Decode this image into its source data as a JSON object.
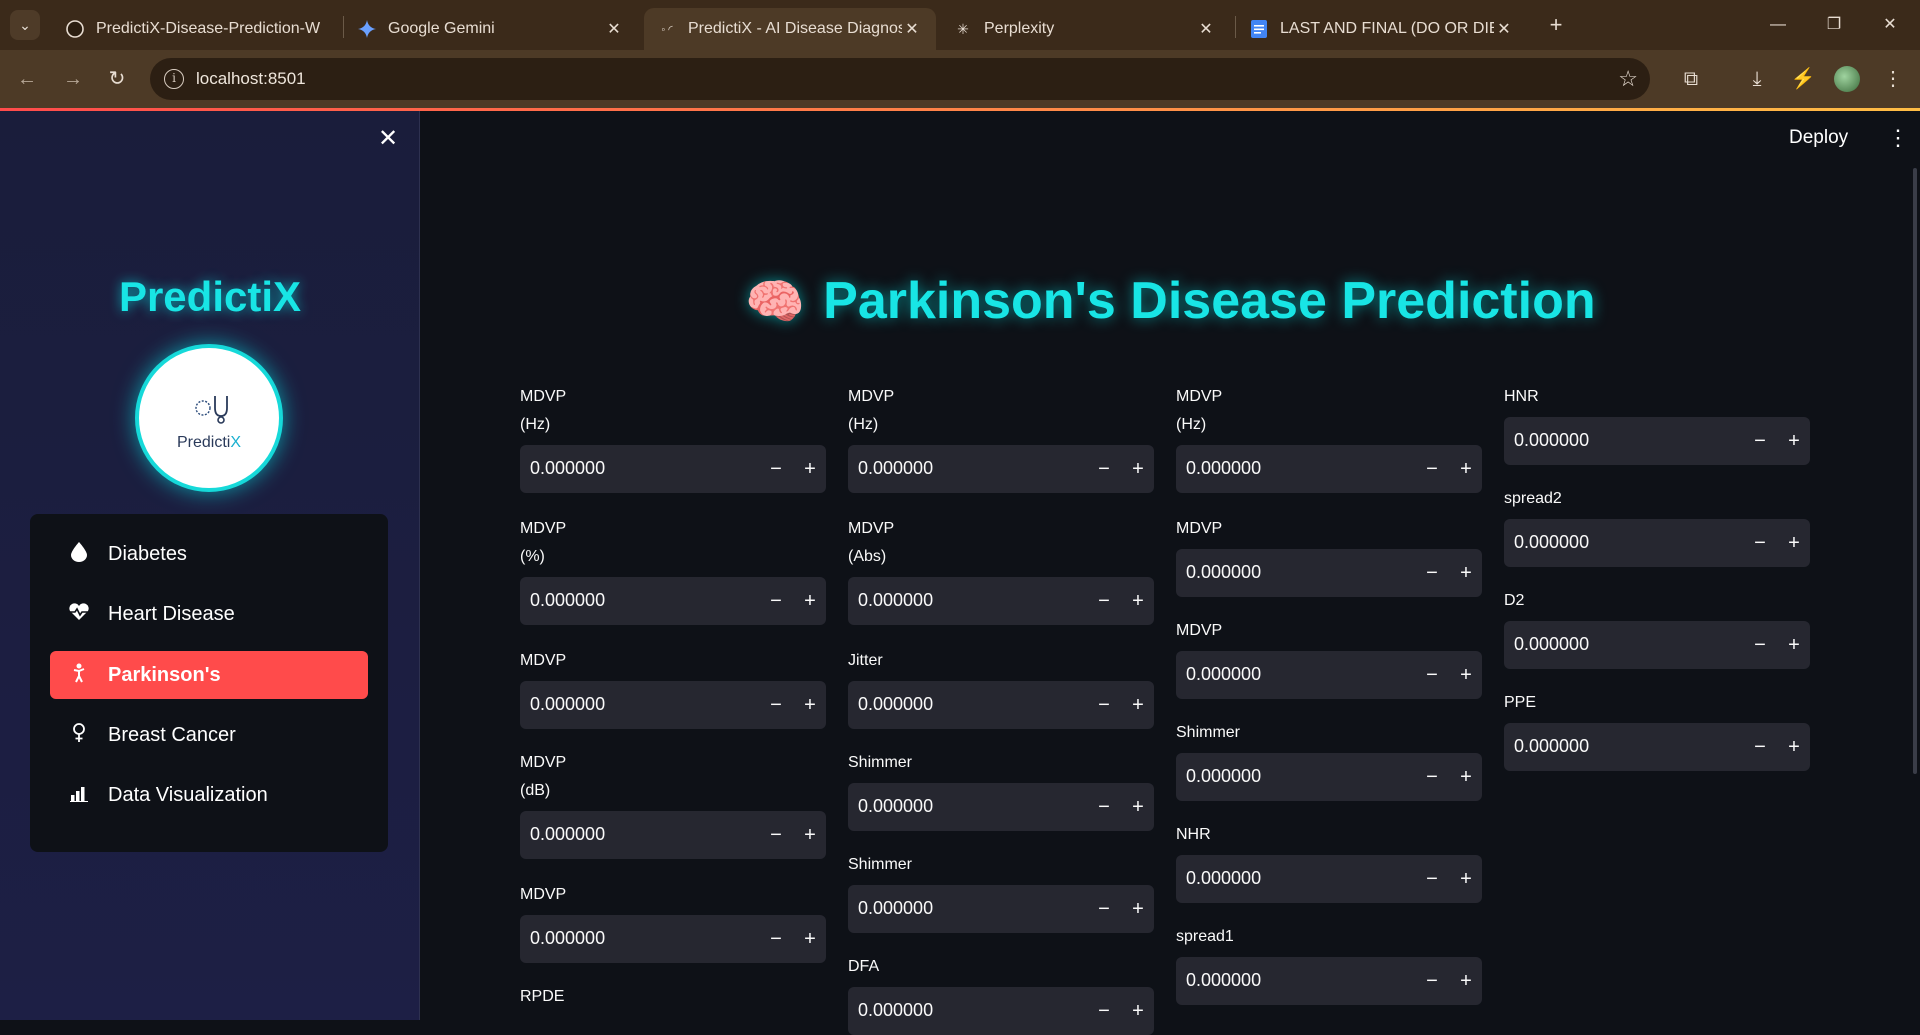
{
  "browser": {
    "tabs": [
      {
        "title": "PredictiX-Disease-Prediction-W",
        "icon": "github-icon"
      },
      {
        "title": "Google Gemini",
        "icon": "gemini-icon"
      },
      {
        "title": "PredictiX - AI Disease Diagnosis",
        "icon": "loading-icon",
        "active": true
      },
      {
        "title": "Perplexity",
        "icon": "perplexity-icon"
      },
      {
        "title": "LAST AND FINAL (DO OR DIE) -",
        "icon": "docs-icon"
      }
    ],
    "url": "localhost:8501"
  },
  "sidebar": {
    "brand": "PredictiX",
    "logo_text_a": "Predicti",
    "logo_text_b": "X",
    "menu": [
      {
        "label": "Diabetes",
        "icon": "droplet-icon"
      },
      {
        "label": "Heart Disease",
        "icon": "heartbeat-icon"
      },
      {
        "label": "Parkinson's",
        "icon": "person-icon",
        "active": true
      },
      {
        "label": "Breast Cancer",
        "icon": "female-icon"
      },
      {
        "label": "Data Visualization",
        "icon": "bar-chart-icon"
      }
    ]
  },
  "header": {
    "deploy": "Deploy"
  },
  "main": {
    "title": "Parkinson's Disease Prediction",
    "columns": [
      [
        {
          "label1": "MDVP",
          "label2": "(Hz)",
          "value": "0.000000"
        },
        {
          "label1": "MDVP",
          "label2": "(%)",
          "value": "0.000000"
        },
        {
          "label1": "MDVP",
          "label2": "",
          "value": "0.000000"
        },
        {
          "label1": "MDVP",
          "label2": "(dB)",
          "value": "0.000000"
        },
        {
          "label1": "MDVP",
          "label2": "",
          "value": "0.000000"
        },
        {
          "label1": "RPDE",
          "label2": "",
          "value": ""
        }
      ],
      [
        {
          "label1": "MDVP",
          "label2": "(Hz)",
          "value": "0.000000"
        },
        {
          "label1": "MDVP",
          "label2": "(Abs)",
          "value": "0.000000"
        },
        {
          "label1": "Jitter",
          "label2": "",
          "value": "0.000000"
        },
        {
          "label1": "Shimmer",
          "label2": "",
          "value": "0.000000"
        },
        {
          "label1": "Shimmer",
          "label2": "",
          "value": "0.000000"
        },
        {
          "label1": "DFA",
          "label2": "",
          "value": "0.000000"
        }
      ],
      [
        {
          "label1": "MDVP",
          "label2": "(Hz)",
          "value": "0.000000"
        },
        {
          "label1": "MDVP",
          "label2": "",
          "value": "0.000000"
        },
        {
          "label1": "MDVP",
          "label2": "",
          "value": "0.000000"
        },
        {
          "label1": "Shimmer",
          "label2": "",
          "value": "0.000000"
        },
        {
          "label1": "NHR",
          "label2": "",
          "value": "0.000000"
        },
        {
          "label1": "spread1",
          "label2": "",
          "value": "0.000000"
        }
      ],
      [
        {
          "label1": "HNR",
          "label2": "",
          "value": "0.000000"
        },
        {
          "label1": "spread2",
          "label2": "",
          "value": "0.000000"
        },
        {
          "label1": "D2",
          "label2": "",
          "value": "0.000000"
        },
        {
          "label1": "PPE",
          "label2": "",
          "value": "0.000000"
        }
      ]
    ]
  }
}
